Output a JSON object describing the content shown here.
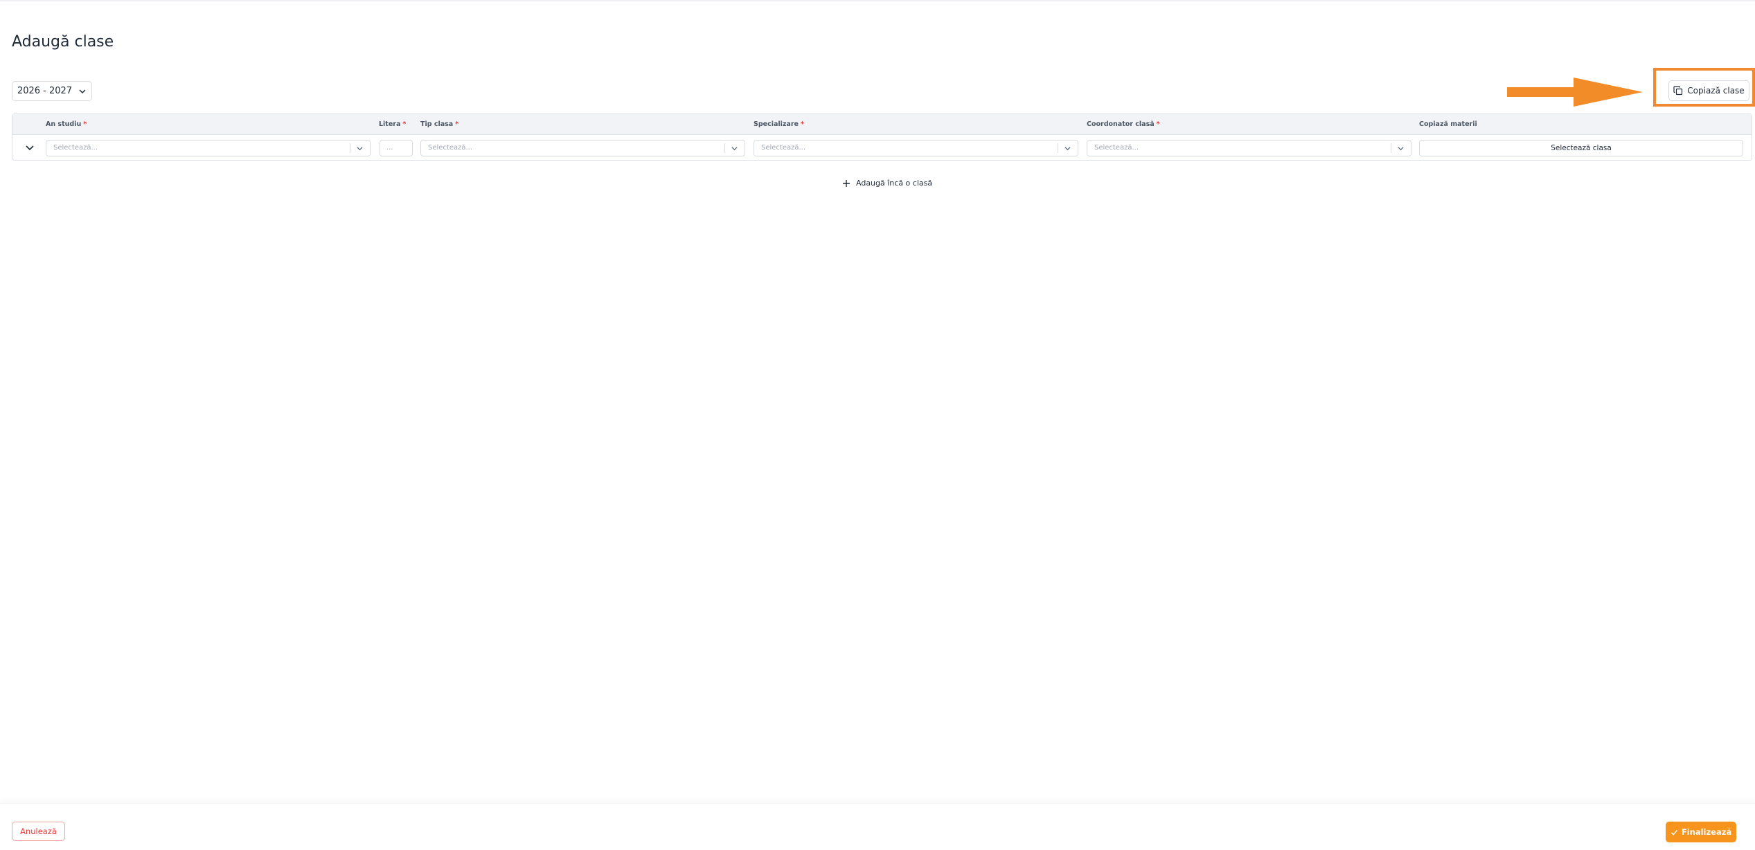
{
  "page": {
    "title": "Adaugă clase"
  },
  "toolbar": {
    "year": "2026 - 2027",
    "copy_label": "Copiază clase"
  },
  "table": {
    "columns": [
      {
        "label": "An studiu",
        "required": "*"
      },
      {
        "label": "Litera",
        "required": "*"
      },
      {
        "label": "Tip clasa",
        "required": "*"
      },
      {
        "label": "Specializare",
        "required": "*"
      },
      {
        "label": "Coordonator clasă",
        "required": "*"
      },
      {
        "label": "Copiază materii",
        "required": ""
      }
    ],
    "row": {
      "an_studiu_placeholder": "Selectează...",
      "litera_placeholder": "...",
      "tip_clasa_placeholder": "Selectează...",
      "specializare_placeholder": "Selectează...",
      "coordonator_placeholder": "Selectează...",
      "copiaza_button": "Selectează clasa"
    }
  },
  "add_more_label": "Adaugă încă o clasă",
  "footer": {
    "cancel_label": "Anulează",
    "finish_label": "Finalizează"
  },
  "colors": {
    "accent": "#f7941d",
    "highlight": "#f0892f",
    "danger": "#e53935"
  },
  "icons": [
    "chevron-down-icon",
    "copy-icon",
    "arrow-right-icon",
    "plus-icon",
    "check-icon"
  ]
}
